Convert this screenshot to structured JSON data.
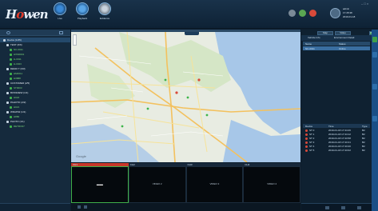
{
  "header": {
    "logo": "H",
    "logo_rest": "wen",
    "nav": [
      {
        "label": "Live",
        "icon": "live-icon"
      },
      {
        "label": "Playback",
        "icon": "playback-icon"
      },
      {
        "label": "Evidence",
        "icon": "evidence-icon"
      }
    ],
    "user": {
      "name": "admin",
      "line2": "17:45:38",
      "line3": "2019-01-18"
    }
  },
  "left": {
    "tree": [
      {
        "label": "Device (1/25)",
        "icon": "folder-icon",
        "color": "#e6eef6",
        "level": 0
      },
      {
        "label": "TEST (6/6)",
        "icon": "folder-icon",
        "color": "#e6eef6",
        "level": 1
      },
      {
        "label": "NC-0011",
        "icon": "vehicle-online-icon",
        "color": "#7ad67a",
        "level": 2
      },
      {
        "label": "HXM0001",
        "icon": "vehicle-online-icon",
        "color": "#7ad67a",
        "level": 2
      },
      {
        "label": "H-0011",
        "icon": "vehicle-online-icon",
        "color": "#7ad67a",
        "level": 2
      },
      {
        "label": "H-0023",
        "icon": "vehicle-online-icon",
        "color": "#7ad67a",
        "level": 2
      },
      {
        "label": "DEMO T (3/3)",
        "icon": "folder-icon",
        "color": "#e6eef6",
        "level": 1
      },
      {
        "label": "HM0011",
        "icon": "vehicle-online-icon",
        "color": "#7ad67a",
        "level": 2
      },
      {
        "label": "H3888",
        "icon": "vehicle-online-icon",
        "color": "#7ad67a",
        "level": 2
      },
      {
        "label": "CUSTOMER (2/5)",
        "icon": "folder-icon",
        "color": "#e6eef6",
        "level": 1
      },
      {
        "label": "ST0003",
        "icon": "vehicle-online-icon",
        "color": "#7ad67a",
        "level": 2
      },
      {
        "label": "BOSSNEW (1/1)",
        "icon": "folder-icon",
        "color": "#e6eef6",
        "level": 1
      },
      {
        "label": "H022",
        "icon": "vehicle-online-icon",
        "color": "#7ad67a",
        "level": 2
      },
      {
        "label": "PAHOTO (2/2)",
        "icon": "folder-icon",
        "color": "#e6eef6",
        "level": 1
      },
      {
        "label": "H021",
        "icon": "vehicle-online-icon",
        "color": "#7ad67a",
        "level": 2
      },
      {
        "label": "WRAP02 (1/1)",
        "icon": "folder-icon",
        "color": "#e6eef6",
        "level": 1
      },
      {
        "label": "H880",
        "icon": "vehicle-online-icon",
        "color": "#7ad67a",
        "level": 2
      },
      {
        "label": "PHOTO (1/1)",
        "icon": "folder-icon",
        "color": "#e6eef6",
        "level": 1
      },
      {
        "label": "RETRO07",
        "icon": "vehicle-online-icon",
        "color": "#7ad67a",
        "level": 2
      }
    ]
  },
  "map": {
    "badge": "Google"
  },
  "video": {
    "tiles": [
      {
        "tab": "CH1",
        "label": "▬▬",
        "active": true
      },
      {
        "tab": "CH2",
        "label": "VIDEO 2",
        "active": false
      },
      {
        "tab": "CH3",
        "label": "VIDEO 3",
        "active": false
      },
      {
        "tab": "CH4",
        "label": "VIDEO 4",
        "active": false
      }
    ]
  },
  "right": {
    "top_buttons": [
      "Map",
      "Video",
      "Window"
    ],
    "tabs": [
      "Vehicle Info",
      "Environment Detail"
    ],
    "list_headers": [
      "Name",
      "Status"
    ],
    "selected_row": [
      "NC-0011",
      "Online"
    ],
    "alarm_headers": [
      "Device",
      "Time",
      "Type"
    ],
    "alarms": [
      {
        "device": "ST 0",
        "time": "2019-01-18 17:44:26",
        "type": "B2",
        "color": "#d84a3a"
      },
      {
        "device": "ST 1",
        "time": "2019-01-18 17:44:12",
        "type": "B2",
        "color": "#d84a3a"
      },
      {
        "device": "ST 2",
        "time": "2019-01-18 17:43:58",
        "type": "B2",
        "color": "#d84a3a"
      },
      {
        "device": "ST 3",
        "time": "2019-01-18 17:43:41",
        "type": "B2",
        "color": "#d84a3a"
      },
      {
        "device": "ST 4",
        "time": "2019-01-18 17:43:20",
        "type": "B2",
        "color": "#d84a3a"
      },
      {
        "device": "ST 5",
        "time": "2019-01-18 17:43:02",
        "type": "B2",
        "color": "#d84a3a"
      }
    ]
  },
  "colors": {
    "accent": "#2e7fd0",
    "online": "#7ad67a",
    "alarm": "#d84a3a",
    "strip": "#1a4f86"
  }
}
